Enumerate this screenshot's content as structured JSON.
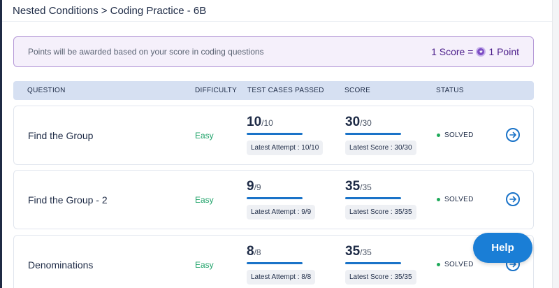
{
  "breadcrumb": "Nested Conditions > Coding Practice - 6B",
  "banner": {
    "text": "Points will be awarded based on your score in coding questions",
    "score_prefix": "1 Score =",
    "score_suffix": "1 Point"
  },
  "columns": {
    "question": "QUESTION",
    "difficulty": "DIFFICULTY",
    "tests": "TEST CASES PASSED",
    "score": "SCORE",
    "status": "STATUS"
  },
  "rows": [
    {
      "title": "Find the Group",
      "difficulty": "Easy",
      "tests_value": "10",
      "tests_total": "/10",
      "tests_pill": "Latest Attempt : 10/10",
      "score_value": "30",
      "score_total": "/30",
      "score_pill": "Latest Score : 30/30",
      "status": "SOLVED"
    },
    {
      "title": "Find the Group - 2",
      "difficulty": "Easy",
      "tests_value": "9",
      "tests_total": "/9",
      "tests_pill": "Latest Attempt : 9/9",
      "score_value": "35",
      "score_total": "/35",
      "score_pill": "Latest Score : 35/35",
      "status": "SOLVED"
    },
    {
      "title": "Denominations",
      "difficulty": "Easy",
      "tests_value": "8",
      "tests_total": "/8",
      "tests_pill": "Latest Attempt : 8/8",
      "score_value": "35",
      "score_total": "/35",
      "score_pill": "Latest Score : 35/35",
      "status": "SOLVED"
    }
  ],
  "help_label": "Help",
  "colors": {
    "accent": "#1a73c8",
    "easy": "#20a36a",
    "solved": "#1faa5a",
    "banner_border": "#b69ad8",
    "score_text": "#4b1d8a"
  },
  "icons": {
    "coin": "star-coin-icon",
    "open": "arrow-right-circle-icon"
  }
}
